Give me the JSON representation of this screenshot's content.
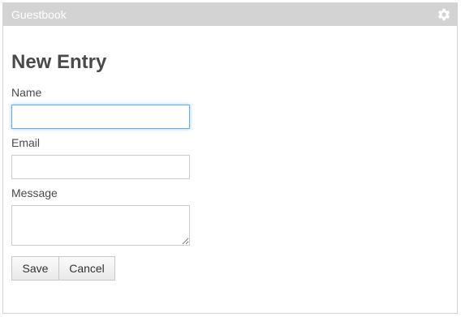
{
  "panel": {
    "title": "Guestbook",
    "settings_icon": "gear-icon",
    "header_bg": "#d3d3d3",
    "focus_color": "#66afe9"
  },
  "form": {
    "heading": "New Entry",
    "name_label": "Name",
    "name_value": "",
    "email_label": "Email",
    "email_value": "",
    "message_label": "Message",
    "message_value": "",
    "save_label": "Save",
    "cancel_label": "Cancel"
  }
}
